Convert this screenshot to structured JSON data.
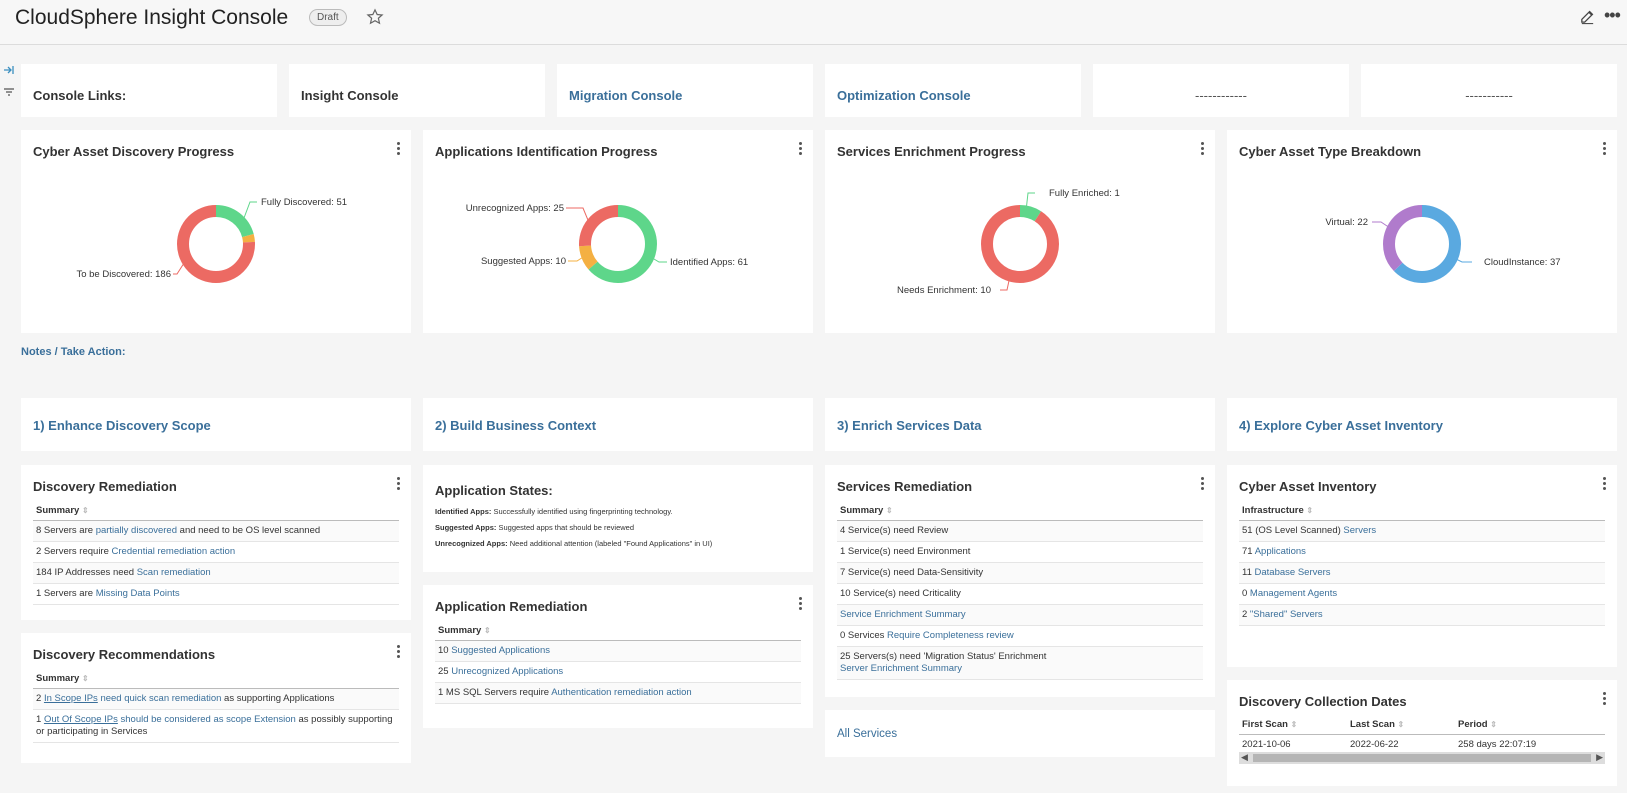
{
  "header": {
    "title": "CloudSphere Insight Console",
    "badge": "Draft"
  },
  "links": {
    "label": "Console Links:",
    "insight": "Insight Console",
    "migration": "Migration Console",
    "optimization": "Optimization Console",
    "blank1": "------------",
    "blank2": "-----------"
  },
  "charts": {
    "discovery": {
      "title": "Cyber Asset Discovery Progress",
      "labels": [
        "Fully Discovered: 51",
        "To be Discovered: 186"
      ]
    },
    "apps": {
      "title": "Applications Identification Progress",
      "labels": [
        "Unrecognized Apps: 25",
        "Suggested Apps: 10",
        "Identified Apps: 61"
      ]
    },
    "services": {
      "title": "Services Enrichment Progress",
      "labels": [
        "Fully Enriched: 1",
        "Needs Enrichment: 10"
      ]
    },
    "types": {
      "title": "Cyber Asset Type Breakdown",
      "labels": [
        "Virtual: 22",
        "CloudInstance: 37"
      ]
    }
  },
  "chart_data": [
    {
      "type": "pie",
      "title": "Cyber Asset Discovery Progress",
      "categories": [
        "Fully Discovered",
        "Partially Discovered",
        "To be Discovered"
      ],
      "values": [
        51,
        8,
        186
      ]
    },
    {
      "type": "pie",
      "title": "Applications Identification Progress",
      "categories": [
        "Identified Apps",
        "Suggested Apps",
        "Unrecognized Apps"
      ],
      "values": [
        61,
        10,
        25
      ]
    },
    {
      "type": "pie",
      "title": "Services Enrichment Progress",
      "categories": [
        "Fully Enriched",
        "Needs Enrichment"
      ],
      "values": [
        1,
        10
      ]
    },
    {
      "type": "pie",
      "title": "Cyber Asset Type Breakdown",
      "categories": [
        "CloudInstance",
        "Virtual"
      ],
      "values": [
        37,
        22
      ]
    }
  ],
  "colors": {
    "green": "#5ed68a",
    "red": "#ec6a63",
    "orange": "#f4b042",
    "blue": "#5aa9e0",
    "purple": "#b07bcc"
  },
  "notes": "Notes / Take Action:",
  "steps": [
    "1) Enhance Discovery Scope",
    "2) Build Business Context",
    "3) Enrich Services Data",
    "4) Explore Cyber Asset Inventory"
  ],
  "disc_rem": {
    "title": "Discovery Remediation",
    "header": "Summary",
    "r1": {
      "n": "8",
      "a": " Servers are ",
      "l": "partially discovered",
      "b": " and need to be OS level scanned"
    },
    "r2": {
      "n": "2",
      "a": " Servers require ",
      "l": "Credential remediation action"
    },
    "r3": {
      "n": "184",
      "a": " IP Addresses need ",
      "l": "Scan remediation"
    },
    "r4": {
      "n": "1",
      "a": " Servers are ",
      "l": "Missing Data Points"
    }
  },
  "disc_rec": {
    "title": "Discovery Recommendations",
    "header": "Summary",
    "r1": {
      "n": "2",
      "l1": "In Scope IPs",
      "l2": " need quick scan remediation",
      "b": " as supporting Applications"
    },
    "r2": {
      "n": "1",
      "l1": "Out Of Scope IPs",
      "l2": " should be considered as scope Extension",
      "b": " as possibly supporting or participating in Services"
    }
  },
  "app_states": {
    "title": "Application States:",
    "l1": {
      "k": "Identified Apps:",
      "v": " Successfully identified using fingerprinting technology."
    },
    "l2": {
      "k": "Suggested Apps:",
      "v": " Suggested apps that should be reviewed"
    },
    "l3": {
      "k": "Unrecognized Apps:",
      "v": " Need additional attention (labeled \"Found Applications\" in UI)"
    }
  },
  "app_rem": {
    "title": "Application Remediation",
    "header": "Summary",
    "r1": {
      "n": "10",
      "l": " Suggested Applications"
    },
    "r2": {
      "n": "25",
      "l": " Unrecognized Applications"
    },
    "r3": {
      "n": "1",
      "a": " MS SQL Servers require ",
      "l": "Authentication remediation action"
    }
  },
  "svc_rem": {
    "title": "Services Remediation",
    "header": "Summary",
    "r1": {
      "n": "4",
      "a": " Service(s) need Review"
    },
    "r2": {
      "n": "1",
      "a": " Service(s) need Environment"
    },
    "r3": {
      "n": "7",
      "a": " Service(s) need Data-Sensitivity"
    },
    "r4": {
      "n": "10",
      "a": " Service(s) need Criticality"
    },
    "r5": {
      "l": "Service Enrichment Summary"
    },
    "r6": {
      "n": "0",
      "a": " Services ",
      "l": "Require Completeness review"
    },
    "r7": {
      "n": "25",
      "a": " Servers(s) need 'Migration Status' Enrichment",
      "l": "Server Enrichment Summary"
    }
  },
  "all_services": "All Services",
  "inventory": {
    "title": "Cyber Asset Inventory",
    "header": "Infrastructure",
    "r1": {
      "n": "51",
      "a": " (OS Level Scanned) ",
      "l": "Servers"
    },
    "r2": {
      "n": "71",
      "l": " Applications"
    },
    "r3": {
      "n": "11",
      "l": " Database Servers"
    },
    "r4": {
      "n": "0",
      "l": " Management Agents"
    },
    "r5": {
      "n": "2",
      "l": " \"Shared\" Servers"
    }
  },
  "dates": {
    "title": "Discovery Collection Dates",
    "h1": "First Scan",
    "h2": "Last Scan",
    "h3": "Period",
    "first": "2021-10-06",
    "last": "2022-06-22",
    "period": "258 days 22:07:19"
  }
}
